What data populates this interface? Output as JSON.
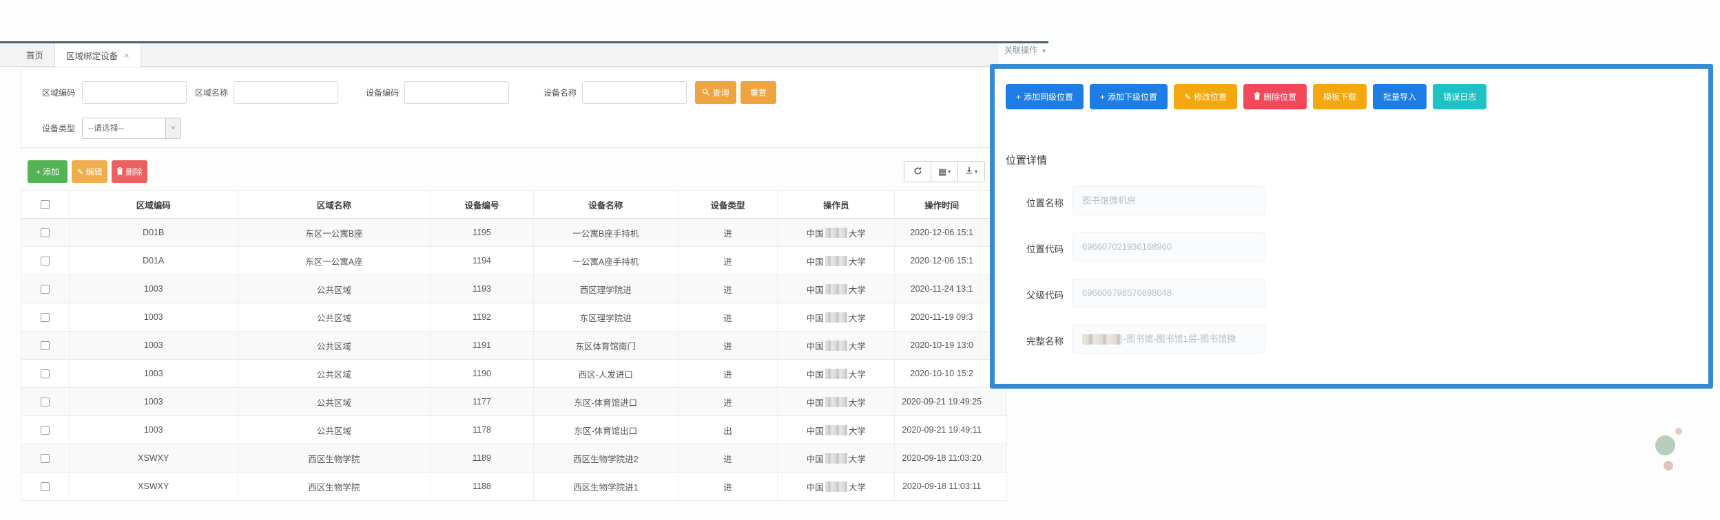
{
  "page": {
    "link_ops_label": "关联操作"
  },
  "tabs": {
    "home": "首页",
    "active": "区域绑定设备"
  },
  "search": {
    "region_code_label": "区域编码",
    "region_name_label": "区域名称",
    "device_code_label": "设备编码",
    "device_name_label": "设备名称",
    "query_label": "查询",
    "reset_label": "重置",
    "device_type_label": "设备类型",
    "device_type_value": "--请选择--"
  },
  "toolbar": {
    "add_label": "添加",
    "edit_label": "编辑",
    "delete_label": "删除"
  },
  "table": {
    "headers": [
      "区域编码",
      "区域名称",
      "设备编号",
      "设备名称",
      "设备类型",
      "操作员",
      "操作时间"
    ],
    "rows": [
      {
        "region_code": "D01B",
        "region_name": "东区一公寓B座",
        "device_no": "1195",
        "device_name": "一公寓B座手持机",
        "device_type": "进",
        "operator_prefix": "中国",
        "operator_suffix": "大学",
        "op_time": "2020-12-06 15:1"
      },
      {
        "region_code": "D01A",
        "region_name": "东区一公寓A座",
        "device_no": "1194",
        "device_name": "一公寓A座手持机",
        "device_type": "进",
        "operator_prefix": "中国",
        "operator_suffix": "大学",
        "op_time": "2020-12-06 15:1"
      },
      {
        "region_code": "1003",
        "region_name": "公共区域",
        "device_no": "1193",
        "device_name": "西区理学院进",
        "device_type": "进",
        "operator_prefix": "中国",
        "operator_suffix": "大学",
        "op_time": "2020-11-24 13:1"
      },
      {
        "region_code": "1003",
        "region_name": "公共区域",
        "device_no": "1192",
        "device_name": "东区理学院进",
        "device_type": "进",
        "operator_prefix": "中国",
        "operator_suffix": "大学",
        "op_time": "2020-11-19 09:3"
      },
      {
        "region_code": "1003",
        "region_name": "公共区域",
        "device_no": "1191",
        "device_name": "东区体育馆南门",
        "device_type": "进",
        "operator_prefix": "中国",
        "operator_suffix": "大学",
        "op_time": "2020-10-19 13:0"
      },
      {
        "region_code": "1003",
        "region_name": "公共区域",
        "device_no": "1190",
        "device_name": "西区-人发进口",
        "device_type": "进",
        "operator_prefix": "中国",
        "operator_suffix": "大学",
        "op_time": "2020-10-10 15:2"
      },
      {
        "region_code": "1003",
        "region_name": "公共区域",
        "device_no": "1177",
        "device_name": "东区-体育馆进口",
        "device_type": "进",
        "operator_prefix": "中国",
        "operator_suffix": "大学",
        "op_time": "2020-09-21 19:49:25"
      },
      {
        "region_code": "1003",
        "region_name": "公共区域",
        "device_no": "1178",
        "device_name": "东区-体育馆出口",
        "device_type": "出",
        "operator_prefix": "中国",
        "operator_suffix": "大学",
        "op_time": "2020-09-21 19:49:11"
      },
      {
        "region_code": "XSWXY",
        "region_name": "西区生物学院",
        "device_no": "1189",
        "device_name": "西区生物学院进2",
        "device_type": "进",
        "operator_prefix": "中国",
        "operator_suffix": "大学",
        "op_time": "2020-09-18 11:03:20"
      },
      {
        "region_code": "XSWXY",
        "region_name": "西区生物学院",
        "device_no": "1188",
        "device_name": "西区生物学院进1",
        "device_type": "进",
        "operator_prefix": "中国",
        "operator_suffix": "大学",
        "op_time": "2020-09-18 11:03:11"
      }
    ]
  },
  "panel": {
    "title": "位置详情",
    "buttons": [
      {
        "label": "添加同级位置",
        "icon": "plus",
        "color": "#1d7de4"
      },
      {
        "label": "添加下级位置",
        "icon": "plus",
        "color": "#1d7de4"
      },
      {
        "label": "修改位置",
        "icon": "pencil",
        "color": "#f5a70f"
      },
      {
        "label": "删除位置",
        "icon": "trash",
        "color": "#f3485a"
      },
      {
        "label": "模板下载",
        "icon": "none",
        "color": "#f5a70f"
      },
      {
        "label": "批量导入",
        "icon": "none",
        "color": "#1d7de4"
      },
      {
        "label": "错误日志",
        "icon": "none",
        "color": "#1ec2c4"
      }
    ],
    "fields": [
      {
        "label": "位置名称",
        "value": "图书馆微机房",
        "redacted_prefix": false
      },
      {
        "label": "位置代码",
        "value": "696607021936168960",
        "redacted_prefix": false
      },
      {
        "label": "父级代码",
        "value": "696606798576898048",
        "redacted_prefix": false
      },
      {
        "label": "完整名称",
        "value": "-图书馆-图书馆1层-图书馆微",
        "redacted_prefix": true
      }
    ]
  },
  "colors": {
    "panel_border": "#348bd3",
    "query_button": "#f0a43f",
    "add_button": "#54b354",
    "edit_button": "#f0ad4e",
    "delete_button": "#ec6060",
    "tab_accent_line": "#47626e"
  }
}
